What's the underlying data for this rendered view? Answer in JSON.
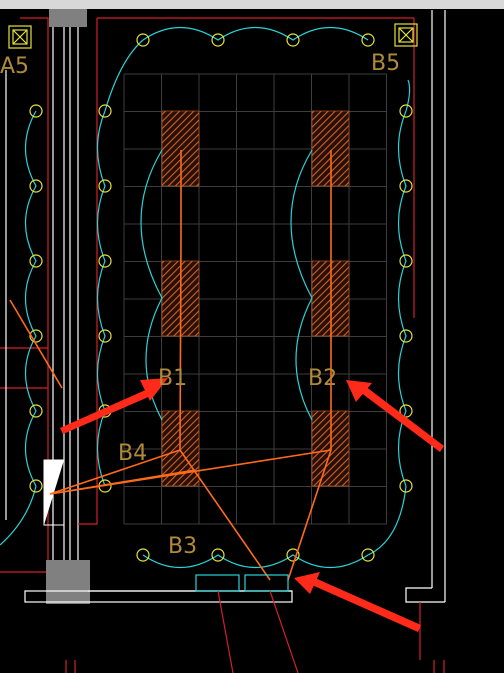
{
  "drawing": {
    "labels": {
      "a5": "A5",
      "b5": "B5",
      "b1": "B1",
      "b2": "B2",
      "b3": "B3",
      "b4": "B4"
    },
    "colors": {
      "background": "#000000",
      "wall": "#ffffff",
      "boundary": "#d2202a",
      "grid": "#3d3d3d",
      "hatch": "#c8622a",
      "circuit": "#29d3d8",
      "fixture": "#e6e23a",
      "wiring": "#ff6a1a",
      "arrow": "#ff2a1a",
      "label": "#b08a3a",
      "column": "#808080"
    },
    "icons": [
      "square-target-icon",
      "fixture-circle-icon",
      "arrow-icon"
    ]
  }
}
